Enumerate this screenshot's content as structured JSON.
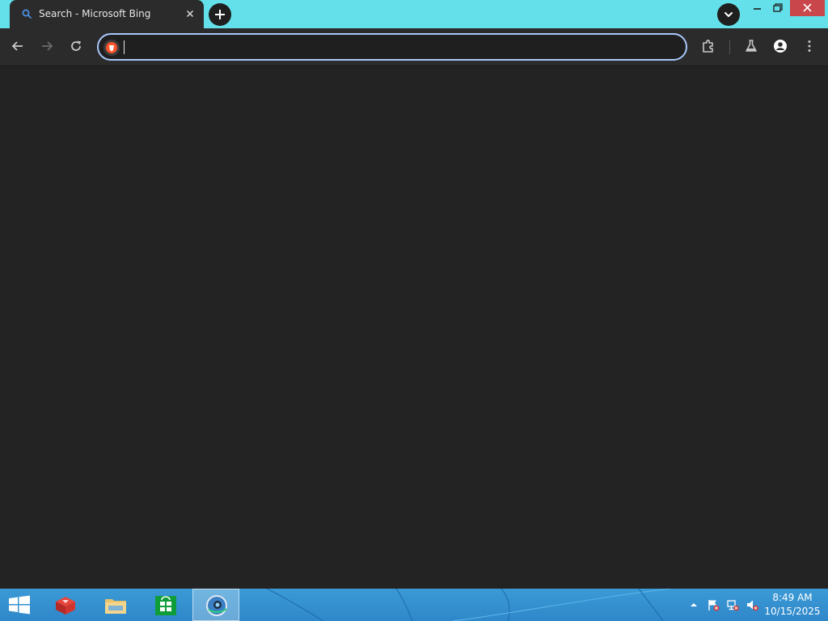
{
  "browser": {
    "tab": {
      "title": "Search - Microsoft Bing",
      "favicon": "bing-search-icon",
      "close_icon": "close-icon"
    },
    "new_tab_icon": "plus-icon",
    "tab_search_icon": "chevron-down-icon",
    "window_controls": [
      "minimize-icon",
      "restore-icon",
      "close-icon"
    ],
    "toolbar": {
      "back_icon": "arrow-left-icon",
      "forward_icon": "arrow-right-icon",
      "reload_icon": "reload-icon",
      "extensions_icon": "puzzle-icon",
      "labs_icon": "flask-icon",
      "profile_icon": "person-icon",
      "menu_icon": "kebab-menu-icon"
    },
    "omnibox": {
      "value": "",
      "placeholder": "",
      "site_icon": "brave-lion-icon"
    },
    "colors": {
      "tabstrip": "#63e0ea",
      "toolbar": "#2b2b2b",
      "content": "#232323",
      "omnibox_border": "#a8c7fa",
      "close_button": "#c9464b"
    }
  },
  "taskbar": {
    "start_icon": "windows-logo-icon",
    "apps": [
      {
        "name": "app-red-cube",
        "icon": "red-cube-icon",
        "active": false
      },
      {
        "name": "file-explorer",
        "icon": "folder-icon",
        "active": false
      },
      {
        "name": "store",
        "icon": "store-bag-icon",
        "active": false
      },
      {
        "name": "browser",
        "icon": "globe-browser-icon",
        "active": true
      }
    ],
    "tray": [
      "show-hidden-icons-icon",
      "flag-error-icon",
      "network-error-icon",
      "volume-muted-icon"
    ],
    "clock": {
      "time": "8:49 AM",
      "date": "10/15/2025"
    },
    "colors": {
      "bar": "#3b9ad6"
    }
  }
}
